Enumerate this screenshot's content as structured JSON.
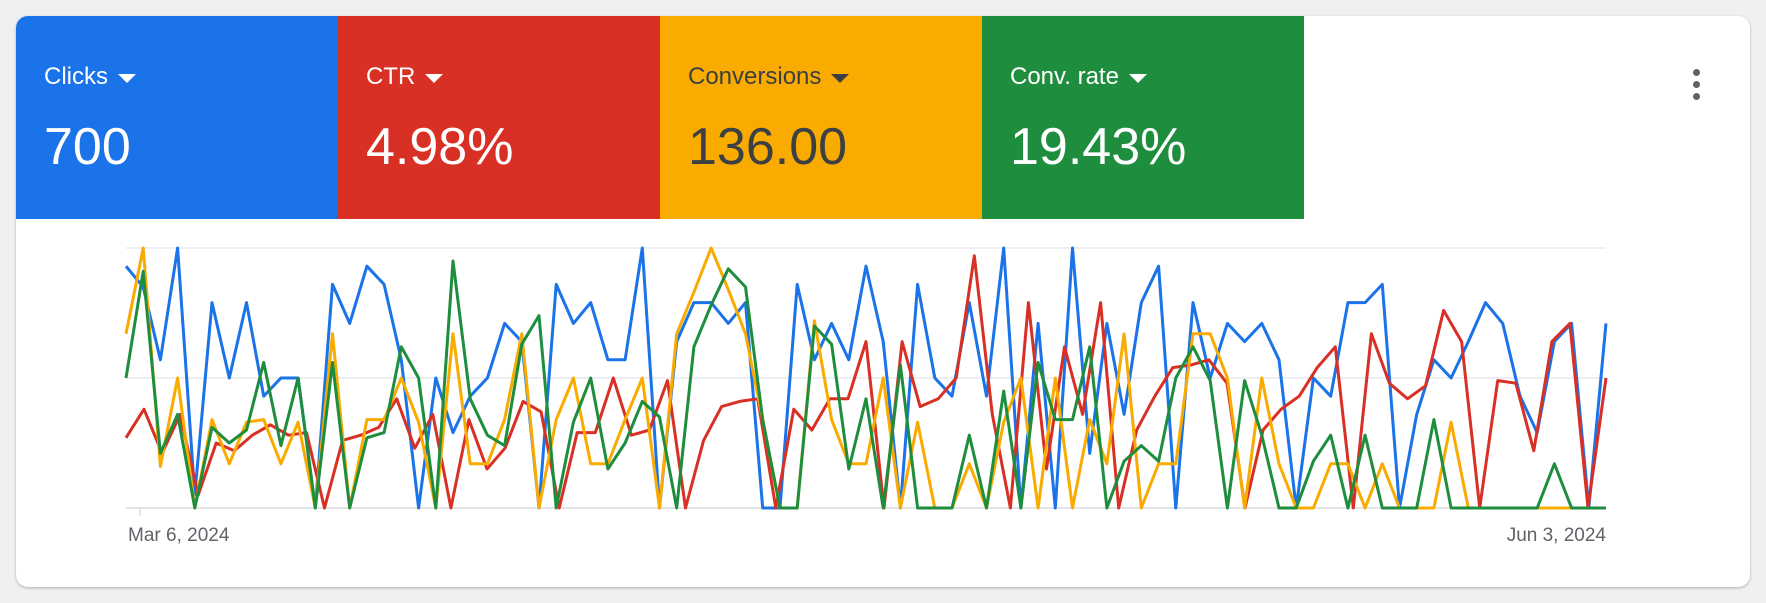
{
  "metrics": [
    {
      "label": "Clicks",
      "value": "700",
      "bg": "#1a73e8",
      "fg": "#ffffff"
    },
    {
      "label": "CTR",
      "value": "4.98%",
      "bg": "#d93025",
      "fg": "#ffffff"
    },
    {
      "label": "Conversions",
      "value": "136.00",
      "bg": "#f9ab00",
      "fg": "#3c4043"
    },
    {
      "label": "Conv. rate",
      "value": "19.43%",
      "bg": "#1e8e3e",
      "fg": "#ffffff"
    }
  ],
  "icons": {
    "metric_dropdown": "caret-down-icon",
    "more": "more-vert-icon"
  },
  "chart_data": {
    "type": "line",
    "xlabel": "",
    "ylabel": "",
    "x_start_label": "Mar 6, 2024",
    "x_end_label": "Jun 3, 2024",
    "ylim": [
      0,
      1
    ],
    "grid": true,
    "series": [
      {
        "metric": "Clicks",
        "color": "#1a73e8",
        "values": [
          0.93,
          0.85,
          0.57,
          1.0,
          0.05,
          0.79,
          0.5,
          0.79,
          0.43,
          0.5,
          0.5,
          0.0,
          0.86,
          0.71,
          0.93,
          0.86,
          0.57,
          0.0,
          0.5,
          0.29,
          0.43,
          0.5,
          0.71,
          0.64,
          0.0,
          0.86,
          0.71,
          0.79,
          0.57,
          0.57,
          1.0,
          0.0,
          0.64,
          0.79,
          0.79,
          0.71,
          0.79,
          0.0,
          0.0,
          0.86,
          0.57,
          0.71,
          0.57,
          0.93,
          0.64,
          0.0,
          0.86,
          0.5,
          0.43,
          0.79,
          0.43,
          1.0,
          0.0,
          0.71,
          0.0,
          1.0,
          0.21,
          0.71,
          0.36,
          0.79,
          0.93,
          0.0,
          0.79,
          0.5,
          0.71,
          0.64,
          0.71,
          0.57,
          0.0,
          0.5,
          0.43,
          0.79,
          0.79,
          0.86,
          0.0,
          0.36,
          0.57,
          0.5,
          0.64,
          0.79,
          0.71,
          0.43,
          0.29,
          0.64,
          0.71,
          0.0,
          0.71
        ]
      },
      {
        "metric": "CTR",
        "color": "#d93025",
        "values": [
          0.27,
          0.38,
          0.21,
          0.36,
          0.05,
          0.25,
          0.22,
          0.28,
          0.32,
          0.28,
          0.29,
          0.0,
          0.26,
          0.28,
          0.31,
          0.42,
          0.23,
          0.36,
          0.0,
          0.34,
          0.15,
          0.23,
          0.41,
          0.37,
          0.0,
          0.29,
          0.29,
          0.5,
          0.28,
          0.3,
          0.49,
          0.0,
          0.26,
          0.39,
          0.41,
          0.42,
          0.0,
          0.38,
          0.3,
          0.42,
          0.42,
          0.64,
          0.0,
          0.64,
          0.39,
          0.42,
          0.5,
          0.97,
          0.36,
          0.0,
          0.79,
          0.15,
          0.62,
          0.36,
          0.79,
          0.0,
          0.3,
          0.43,
          0.54,
          0.55,
          0.57,
          0.48,
          0.0,
          0.3,
          0.38,
          0.43,
          0.54,
          0.62,
          0.0,
          0.67,
          0.48,
          0.42,
          0.47,
          0.76,
          0.64,
          0.0,
          0.49,
          0.48,
          0.22,
          0.64,
          0.71,
          0.0,
          0.5
        ]
      },
      {
        "metric": "Conversions",
        "color": "#f9ab00",
        "values": [
          0.67,
          1.0,
          0.16,
          0.5,
          0.0,
          0.34,
          0.17,
          0.33,
          0.34,
          0.17,
          0.33,
          0.0,
          0.67,
          0.0,
          0.34,
          0.34,
          0.5,
          0.33,
          0.0,
          0.67,
          0.17,
          0.17,
          0.34,
          0.67,
          0.0,
          0.34,
          0.5,
          0.17,
          0.17,
          0.34,
          0.5,
          0.0,
          0.67,
          0.83,
          1.0,
          0.84,
          0.67,
          0.34,
          0.0,
          0.0,
          0.72,
          0.34,
          0.17,
          0.17,
          0.5,
          0.0,
          0.33,
          0.0,
          0.0,
          0.17,
          0.0,
          0.33,
          0.5,
          0.0,
          0.5,
          0.0,
          0.34,
          0.17,
          0.67,
          0.0,
          0.17,
          0.17,
          0.67,
          0.67,
          0.5,
          0.0,
          0.5,
          0.17,
          0.0,
          0.0,
          0.17,
          0.17,
          0.0,
          0.17,
          0.0,
          0.0,
          0.0,
          0.33,
          0.0,
          0.0,
          0.0,
          0.0,
          0.0,
          0.0,
          0.0,
          0.0,
          0.0
        ]
      },
      {
        "metric": "Conv. rate",
        "color": "#1e8e3e",
        "values": [
          0.5,
          0.91,
          0.21,
          0.36,
          0.0,
          0.31,
          0.25,
          0.3,
          0.56,
          0.24,
          0.5,
          0.0,
          0.56,
          0.0,
          0.27,
          0.29,
          0.62,
          0.5,
          0.0,
          0.95,
          0.42,
          0.28,
          0.24,
          0.63,
          0.74,
          0.0,
          0.33,
          0.5,
          0.15,
          0.25,
          0.41,
          0.35,
          0.0,
          0.62,
          0.78,
          0.92,
          0.85,
          0.34,
          0.0,
          0.0,
          0.7,
          0.63,
          0.15,
          0.42,
          0.0,
          0.55,
          0.0,
          0.0,
          0.0,
          0.28,
          0.0,
          0.45,
          0.0,
          0.56,
          0.34,
          0.34,
          0.62,
          0.0,
          0.18,
          0.24,
          0.18,
          0.5,
          0.62,
          0.49,
          0.0,
          0.49,
          0.28,
          0.0,
          0.0,
          0.18,
          0.28,
          0.0,
          0.28,
          0.0,
          0.0,
          0.0,
          0.34,
          0.0,
          0.0,
          0.0,
          0.0,
          0.0,
          0.0,
          0.17,
          0.0,
          0.0,
          0.0
        ]
      }
    ]
  }
}
